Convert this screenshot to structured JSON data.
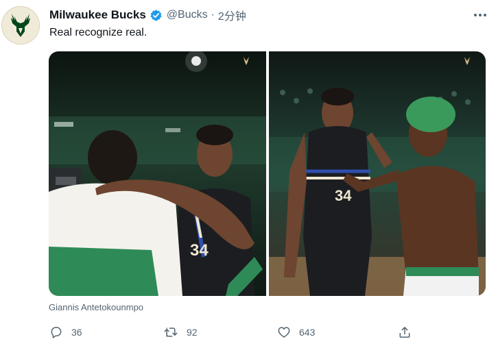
{
  "tweet": {
    "author_name": "Milwaukee Bucks",
    "handle": "@Bucks",
    "separator": "·",
    "time": "2分钟",
    "text": "Real recognize real.",
    "media_caption": "Giannis Antetokounmpo",
    "photos": [
      {
        "jersey_number": "34",
        "jersey_color": "#1b1d21"
      },
      {
        "jersey_number": "34",
        "jersey_color": "#1b1d21"
      }
    ]
  },
  "actions": {
    "reply_count": "36",
    "retweet_count": "92",
    "like_count": "643"
  },
  "icons": [
    "bucks-logo",
    "verified-badge-icon",
    "more-icon",
    "reply-icon",
    "retweet-icon",
    "like-icon",
    "share-icon"
  ],
  "colors": {
    "verified": "#1d9bf0",
    "bucks_green": "#00471b",
    "bucks_cream": "#f0ebd8",
    "secondary_text": "#536471",
    "celtics_green": "#2e8b57"
  }
}
